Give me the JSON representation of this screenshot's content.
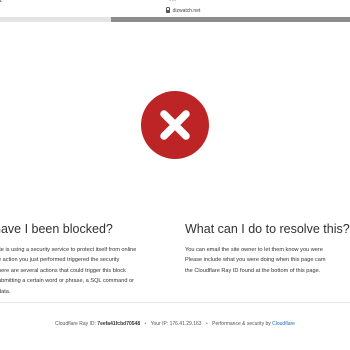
{
  "browser": {
    "edge_char": "z",
    "dots": "•••",
    "url": "dizwatch.net"
  },
  "colors": {
    "error_red": "#bd2426",
    "link_blue": "#1a6ec4",
    "tab_dark": "#8c8c8c"
  },
  "icons": {
    "lock": "lock-icon",
    "error": "error-x-icon"
  },
  "left_column": {
    "title": "have I been blocked?",
    "lines": [
      "ite is using a security service to protect itself from online",
      "e action you just performed triggered the security",
      "here are several actions that could trigger this block",
      "ubmitting a certain word or phrase, a SQL command or",
      "data."
    ]
  },
  "right_column": {
    "title": "What can I do to resolve this?",
    "lines": [
      "You can email the site owner to let them know you were",
      "Please include what you were doing when this page cam",
      "the Cloudflare Ray ID found at the bottom of this page."
    ]
  },
  "footer": {
    "ray_label": "Cloudflare Ray ID:",
    "ray_id": "7eefa41fcbd70548",
    "separator": "•",
    "ip_label": "Your IP:",
    "ip_value": "176.41.29.163",
    "performance_text": "Performance & security by",
    "cloudflare_link": "Cloudflare"
  }
}
